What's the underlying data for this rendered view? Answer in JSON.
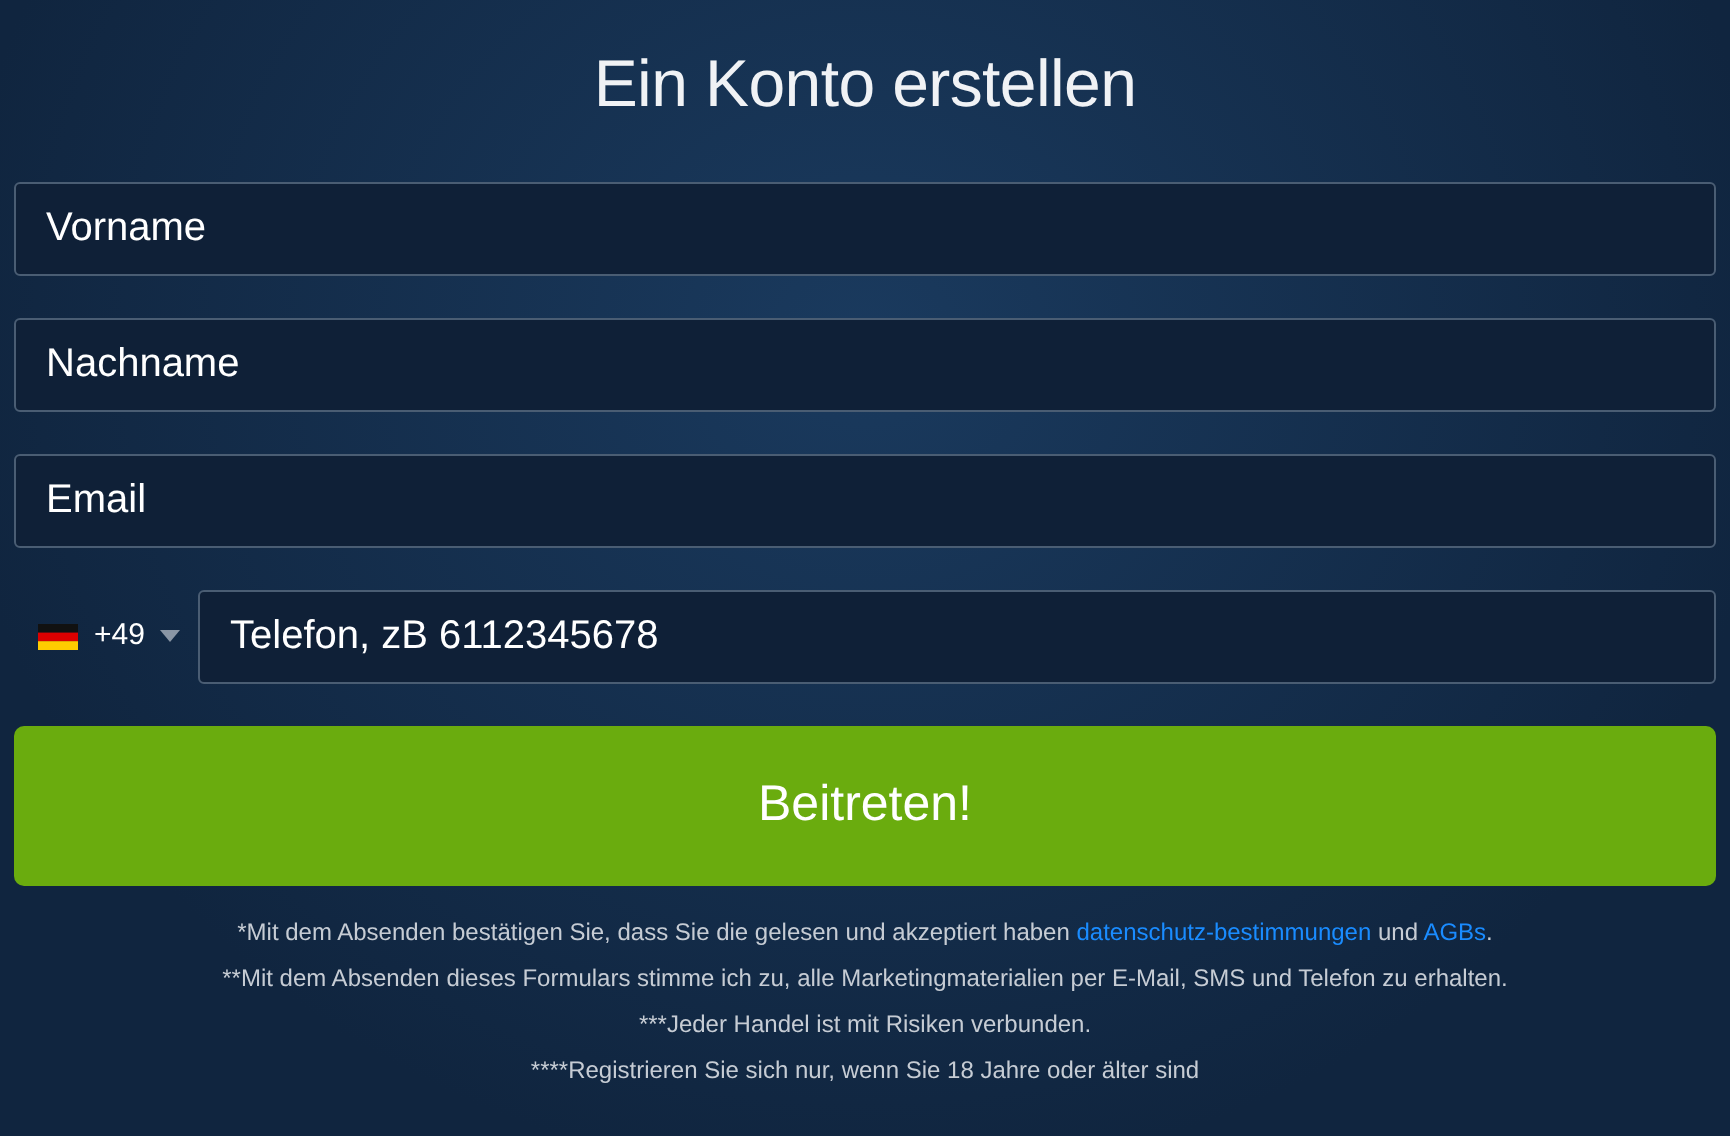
{
  "title": "Ein Konto erstellen",
  "fields": [
    {
      "placeholder": "Vorname"
    },
    {
      "placeholder": "Nachname"
    },
    {
      "placeholder": "Email"
    }
  ],
  "phone": {
    "country_code": "+49",
    "placeholder": "Telefon, zB 6112345678"
  },
  "submit": "Beitreten!",
  "notes": [
    [
      {
        "kind": "text",
        "text": "*Mit dem Absenden bestätigen Sie, dass Sie die gelesen und akzeptiert haben "
      },
      {
        "kind": "link",
        "text": "datenschutz-bestimmungen"
      },
      {
        "kind": "text",
        "text": " und "
      },
      {
        "kind": "link",
        "text": "AGBs"
      },
      {
        "kind": "text",
        "text": "."
      }
    ],
    [
      {
        "kind": "text",
        "text": "**Mit dem Absenden dieses Formulars stimme ich zu, alle Marketingmaterialien per E-Mail, SMS und Telefon zu erhalten."
      }
    ],
    [
      {
        "kind": "text",
        "text": "***Jeder Handel ist mit Risiken verbunden."
      }
    ],
    [
      {
        "kind": "text",
        "text": "****Registrieren Sie sich nur, wenn Sie 18 Jahre oder älter sind"
      }
    ]
  ]
}
